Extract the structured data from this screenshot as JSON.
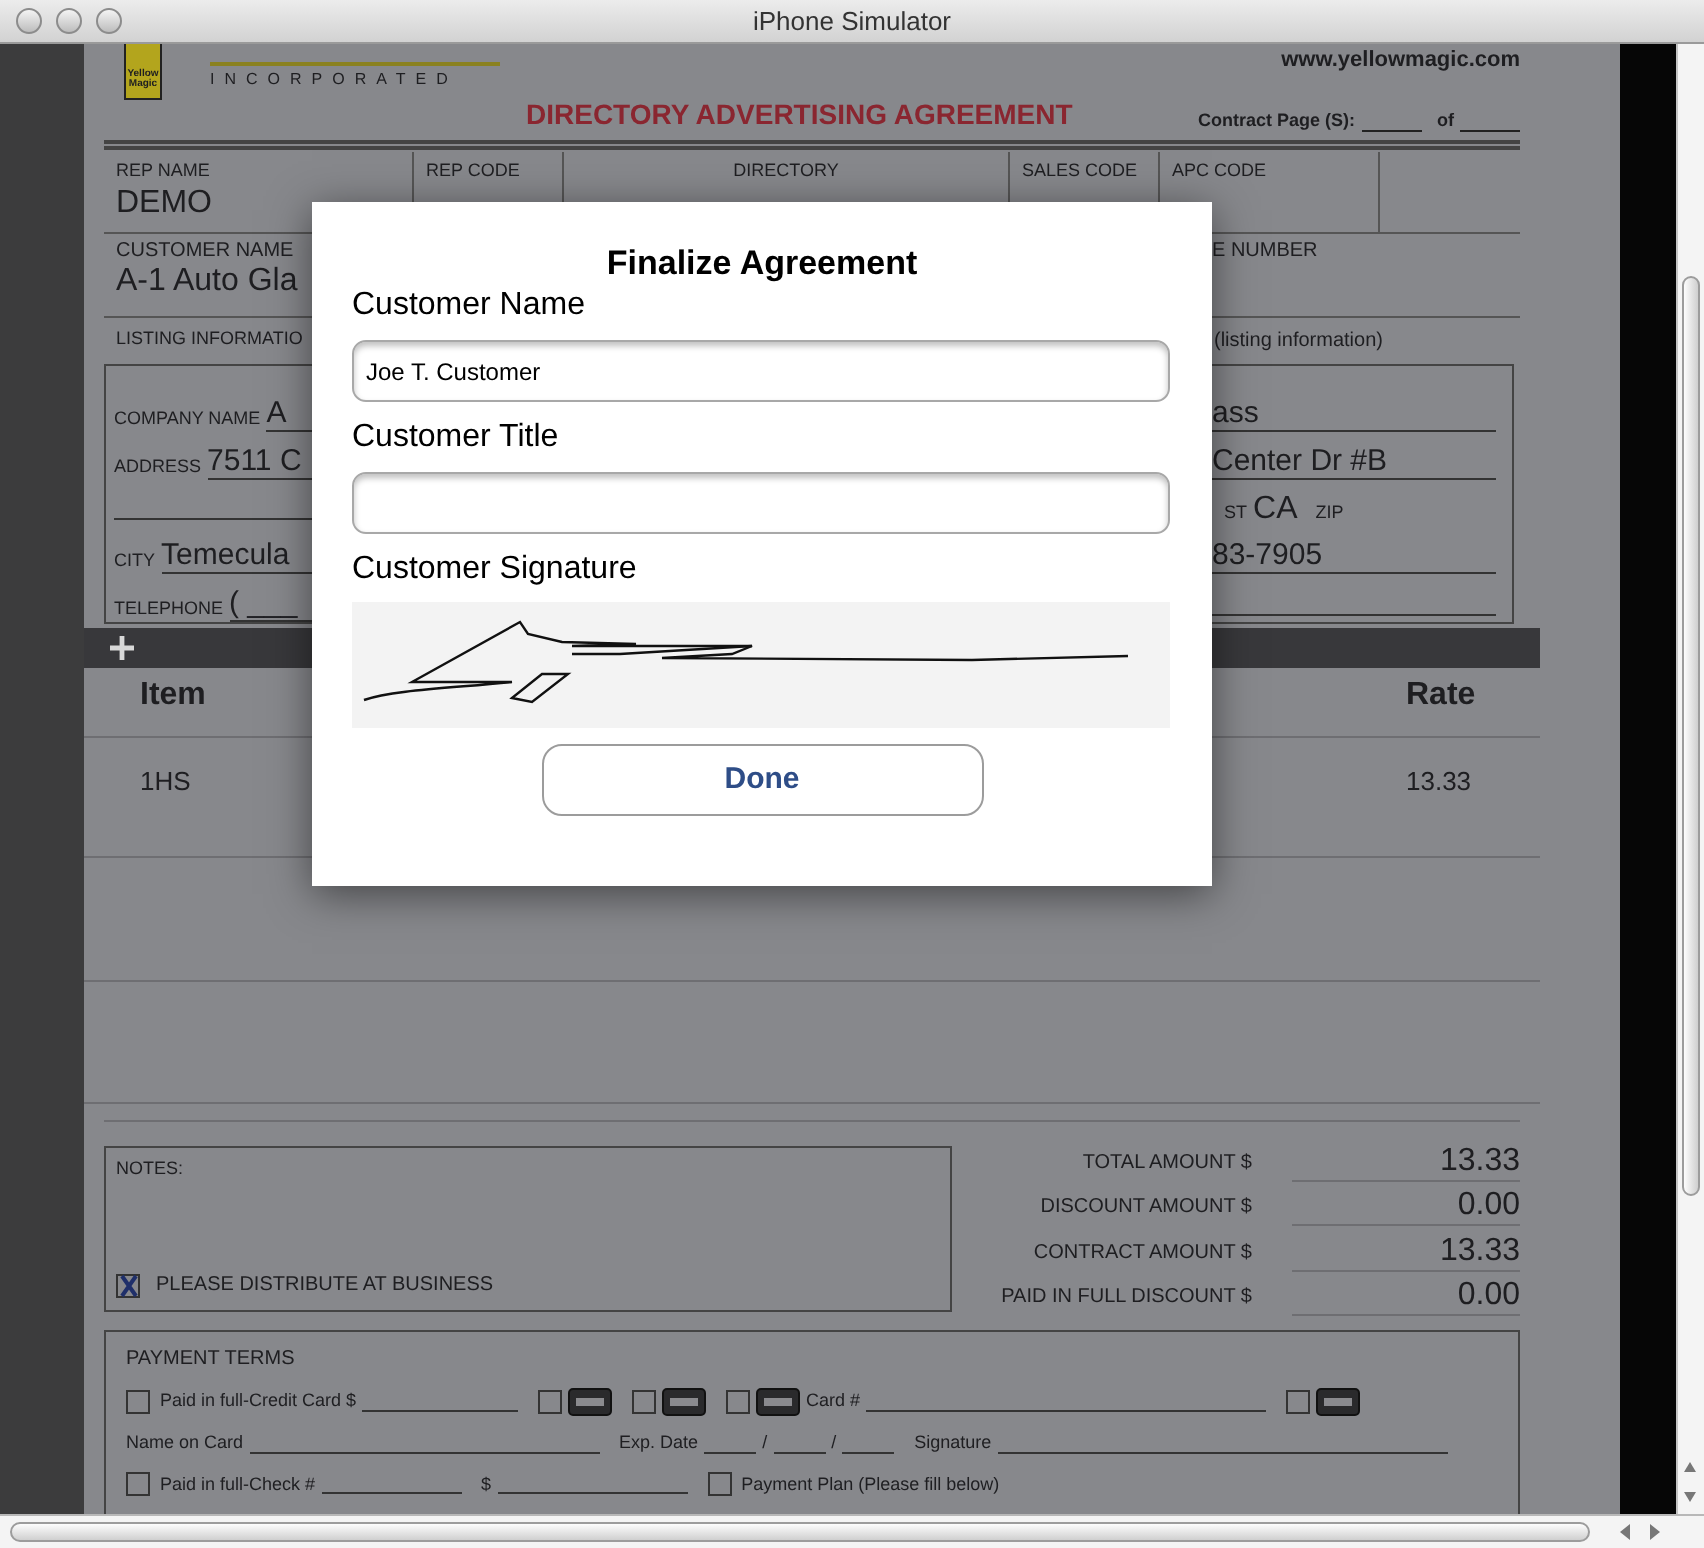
{
  "window": {
    "title": "iPhone Simulator"
  },
  "header": {
    "logo_text": "Yellow Magic",
    "company_sub": "INCORPORATED",
    "website": "www.yellowmagic.com",
    "form_title": "DIRECTORY ADVERTISING AGREEMENT",
    "contract_page": "Contract Page (S):",
    "contract_of": "of"
  },
  "rep_row": [
    {
      "label": "REP NAME",
      "value": "DEMO"
    },
    {
      "label": "REP CODE"
    },
    {
      "label": "DIRECTORY"
    },
    {
      "label": "SALES CODE"
    },
    {
      "label": "APC CODE"
    }
  ],
  "customer_row": {
    "label": "CUSTOMER NAME",
    "value": "A-1 Auto Gla",
    "right_label": "E NUMBER"
  },
  "listing": {
    "label": "LISTING INFORMATIO",
    "note": "(listing information)"
  },
  "listing_left": [
    {
      "kind": "field",
      "label": "COMPANY NAME",
      "value": "A"
    },
    {
      "kind": "field",
      "label": "ADDRESS",
      "value": "7511 C"
    },
    {
      "kind": "blank"
    },
    {
      "kind": "field",
      "label": "CITY",
      "value": "Temecula"
    },
    {
      "kind": "field",
      "label": "TELEPHONE",
      "value": "(  ___"
    }
  ],
  "listing_right": [
    {
      "kind": "value",
      "value": "ass"
    },
    {
      "kind": "value",
      "value": "Center Dr #B"
    },
    {
      "kind": "state",
      "label": "ST",
      "value": "CA",
      "zip_label": "ZIP"
    },
    {
      "kind": "value",
      "value": "83-7905"
    },
    {
      "kind": "blank"
    }
  ],
  "table": {
    "columns": [
      "Item",
      "Rate"
    ],
    "rows": [
      {
        "cells": [
          "1HS",
          "13.33"
        ]
      }
    ]
  },
  "notes": {
    "label": "NOTES:",
    "distribute": {
      "label": "PLEASE DISTRIBUTE AT BUSINESS",
      "checked": true
    }
  },
  "totals": [
    {
      "label": "TOTAL AMOUNT $",
      "value": "13.33"
    },
    {
      "label": "DISCOUNT AMOUNT $",
      "value": "0.00"
    },
    {
      "label": "CONTRACT AMOUNT $",
      "value": "13.33"
    },
    {
      "label": "PAID IN FULL DISCOUNT $",
      "value": "0.00"
    }
  ],
  "payment_terms": {
    "title": "PAYMENT TERMS",
    "rows": [
      [
        {
          "kind": "check",
          "checked": false,
          "label": "Paid in full-Credit Card $"
        },
        {
          "kind": "card",
          "checked": false
        },
        {
          "kind": "card",
          "checked": false
        },
        {
          "kind": "card",
          "checked": false,
          "label": "Card #"
        },
        {
          "kind": "card",
          "checked": false
        }
      ],
      [
        {
          "kind": "field",
          "label": "Name on Card"
        },
        {
          "kind": "date",
          "label": "Exp. Date",
          "separator": "/"
        },
        {
          "kind": "field",
          "label": "Signature"
        }
      ],
      [
        {
          "kind": "check",
          "checked": false,
          "label": "Paid in full-Check  #"
        },
        {
          "kind": "field",
          "label": "$"
        },
        {
          "kind": "check",
          "checked": false,
          "label": "Payment Plan (Please fill below)"
        }
      ]
    ]
  },
  "modal": {
    "title": "Finalize Agreement",
    "fields": [
      {
        "label": "Customer Name",
        "value": "Joe T. Customer"
      },
      {
        "label": "Customer Title"
      }
    ],
    "signature_label": "Customer Signature",
    "button": "Done"
  }
}
